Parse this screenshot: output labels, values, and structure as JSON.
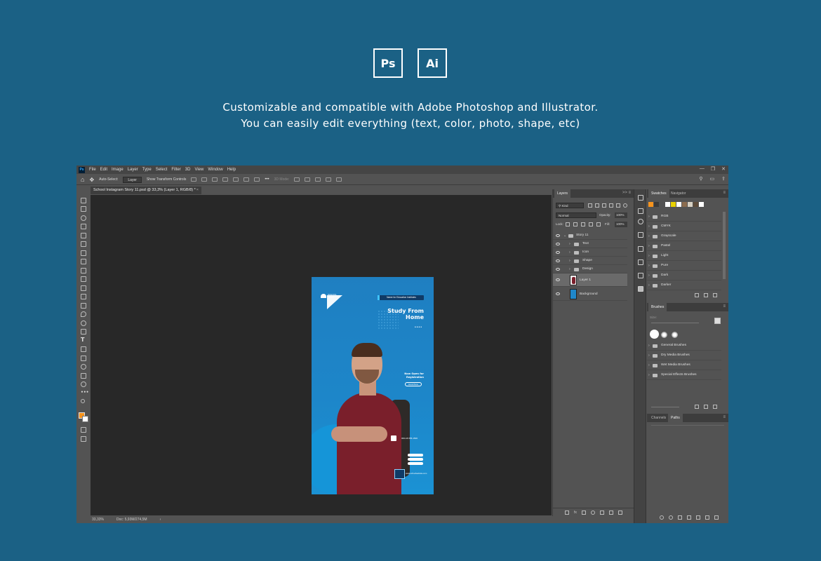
{
  "badges": {
    "ps": "Ps",
    "ai": "Ai"
  },
  "headline": {
    "line1": "Customizable and compatible with Adobe Photoshop and Illustrator.",
    "line2": "You can easily edit everything (text, color, photo, shape, etc)"
  },
  "menubar": {
    "logo": "Ps",
    "items": [
      "File",
      "Edit",
      "Image",
      "Layer",
      "Type",
      "Select",
      "Filter",
      "3D",
      "View",
      "Window",
      "Help"
    ],
    "controls": [
      "—",
      "❐",
      "✕"
    ]
  },
  "options_bar": {
    "auto_select": "Auto-Select:",
    "auto_select_value": "Layer",
    "transform_controls": "Show Transform Controls",
    "more": "•••",
    "mode_3d": "3D Mode:"
  },
  "document_tab": {
    "title": "School Instagram Story 11.psd @ 33,3% (Layer 1, RGB/8) *",
    "close": "×"
  },
  "status_bar": {
    "zoom": "33,33%",
    "doc": "Doc: 5,93M/274,5M",
    "arrow": "›"
  },
  "story": {
    "logo_text": "SCHOOL LOGO",
    "badge": "Name for Education Institutes",
    "title_line1": "Study From",
    "title_line2": "Home",
    "mini_dots": "••••",
    "open_line1": "Now Open for",
    "open_line2": "Registration",
    "enroll": "Enroll Now",
    "phone": "000-18-555-1500",
    "website": "www.schoolwebsite.com"
  },
  "layers_panel": {
    "tab_layers": "Layers",
    "tab_icons": ">> ≡",
    "menu": "≡",
    "kind": "Kind",
    "blend": "Normal",
    "opacity_label": "Opacity:",
    "opacity_value": "100%",
    "lock_label": "Lock:",
    "fill_label": "Fill:",
    "fill_value": "100%",
    "layers": [
      {
        "name": "Story 11"
      },
      {
        "name": "Text"
      },
      {
        "name": "Icon"
      },
      {
        "name": "Shape"
      },
      {
        "name": "Design"
      },
      {
        "name": "Layer 1"
      },
      {
        "name": "Background"
      }
    ]
  },
  "swatches_panel": {
    "tab_swatches": "Swatches",
    "tab_navigator": "Navigator",
    "menu": "≡",
    "colors": [
      "#f7941d",
      "#3a3a3a",
      "#535353",
      "#ffffff",
      "#e8d100",
      "#ffffff",
      "#8c6d4f",
      "#d8d1c4",
      "#5d4b3a",
      "#ffffff"
    ],
    "groups": [
      "RGB",
      "CMYK",
      "Grayscale",
      "Pastel",
      "Light",
      "Pure",
      "Dark",
      "Darker"
    ]
  },
  "brushes_panel": {
    "tab": "Brushes",
    "menu": "≡",
    "size_label": "Size:",
    "groups": [
      "General Brushes",
      "Dry Media Brushes",
      "Wet Media Brushes",
      "Special Effects Brushes"
    ]
  },
  "paths_panel": {
    "tab_channels": "Channels",
    "tab_paths": "Paths",
    "menu": "≡"
  }
}
